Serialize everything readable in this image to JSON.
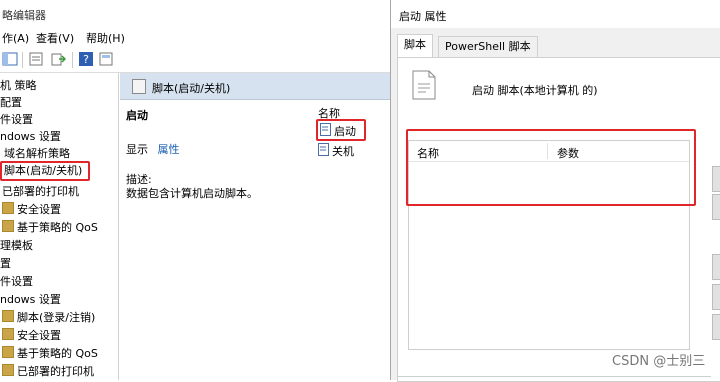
{
  "editor": {
    "title": "略编辑器",
    "menu": [
      {
        "label": "作(A)"
      },
      {
        "label": "查看(V)"
      },
      {
        "label": "帮助(H)"
      }
    ],
    "tree": [
      {
        "label": "机 策略"
      },
      {
        "label": "配置"
      },
      {
        "label": "件设置"
      },
      {
        "label": "ndows 设置"
      },
      {
        "label": "域名解析策略"
      },
      {
        "label": "脚本(启动/关机)"
      },
      {
        "label": "已部署的打印机"
      },
      {
        "label": "安全设置"
      },
      {
        "label": "基于策略的 QoS"
      },
      {
        "label": "理模板"
      },
      {
        "label": "置"
      },
      {
        "label": "件设置"
      },
      {
        "label": "ndows 设置"
      },
      {
        "label": "脚本(登录/注销)"
      },
      {
        "label": "安全设置"
      },
      {
        "label": "基于策略的 QoS"
      },
      {
        "label": "已部署的打印机"
      }
    ],
    "details": {
      "header": "脚本(启动/关机)",
      "section_title": "启动",
      "display_label": "显示",
      "properties_link": "属性",
      "description_label": "描述:",
      "description_text": "数据包含计算机启动脚本。",
      "name_column": "名称",
      "items": [
        {
          "label": "启动"
        },
        {
          "label": "关机"
        }
      ]
    }
  },
  "dialog": {
    "title": "启动 属性",
    "tabs": [
      {
        "label": "脚本"
      },
      {
        "label": "PowerShell 脚本"
      }
    ],
    "header_text": "启动 脚本(本地计算机 的)",
    "table_columns": [
      "名称",
      "参数"
    ]
  },
  "watermark": "CSDN @士别三",
  "colors": {
    "highlight": "#e0262b",
    "details_header": "#d6e2ef",
    "link": "#1a5fb4"
  }
}
